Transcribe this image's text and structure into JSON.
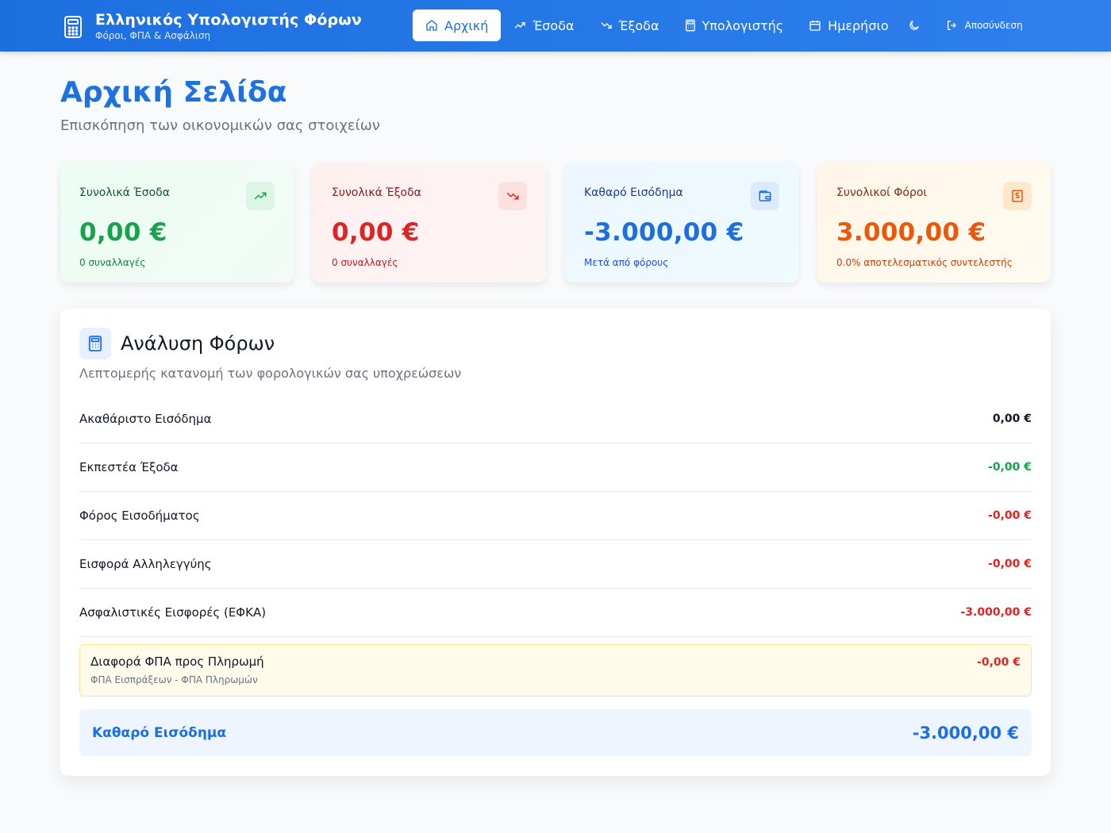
{
  "header": {
    "title": "Ελληνικός Υπολογιστής Φόρων",
    "subtitle": "Φόροι, ΦΠΑ & Ασφάλιση",
    "nav": [
      {
        "label": "Αρχική",
        "icon": "home-icon"
      },
      {
        "label": "Έσοδα",
        "icon": "trending-up-icon"
      },
      {
        "label": "Έξοδα",
        "icon": "trending-down-icon"
      },
      {
        "label": "Υπολογιστής",
        "icon": "calculator-icon"
      },
      {
        "label": "Ημερήσιο",
        "icon": "calendar-icon"
      }
    ],
    "theme_icon": "moon-icon",
    "logout_label": "Αποσύνδεση"
  },
  "page": {
    "title": "Αρχική Σελίδα",
    "subtitle": "Επισκόπηση των οικονομικών σας στοιχείων"
  },
  "cards": [
    {
      "label": "Συνολικά Έσοδα",
      "value": "0,00 €",
      "note": "0 συναλλαγές",
      "icon": "trending-up-icon"
    },
    {
      "label": "Συνολικά Έξοδα",
      "value": "0,00 €",
      "note": "0 συναλλαγές",
      "icon": "trending-down-icon"
    },
    {
      "label": "Καθαρό Εισόδημα",
      "value": "-3.000,00 €",
      "note": "Μετά από φόρους",
      "icon": "wallet-icon"
    },
    {
      "label": "Συνολικοί Φόροι",
      "value": "3.000,00 €",
      "note": "0.0% αποτελεσματικός συντελεστής",
      "icon": "dollar-receipt-icon"
    }
  ],
  "tax": {
    "title": "Ανάλυση Φόρων",
    "subtitle": "Λεπτομερής κατανομή των φορολογικών σας υποχρεώσεων",
    "rows": [
      {
        "label": "Ακαθάριστο Εισόδημα",
        "value": "0,00 €"
      },
      {
        "label": "Εκπεστέα Έξοδα",
        "value": "-0,00 €"
      },
      {
        "label": "Φόρος Εισοδήματος",
        "value": "-0,00 €"
      },
      {
        "label": "Εισφορά Αλληλεγγύης",
        "value": "-0,00 €"
      },
      {
        "label": "Ασφαλιστικές Εισφορές (ΕΦΚΑ)",
        "value": "-3.000,00 €"
      }
    ],
    "vat": {
      "label": "Διαφορά ΦΠΑ προς Πληρωμή",
      "sub": "ΦΠΑ Εισπράξεων - ΦΠΑ Πληρωμών",
      "value": "-0,00 €"
    },
    "net": {
      "label": "Καθαρό Εισόδημα",
      "value": "-3.000,00 €"
    }
  },
  "colors": {
    "brand": "#1d6fe0",
    "positive": "#16a34a",
    "negative": "#dc2626",
    "tax": "#ea580c"
  }
}
